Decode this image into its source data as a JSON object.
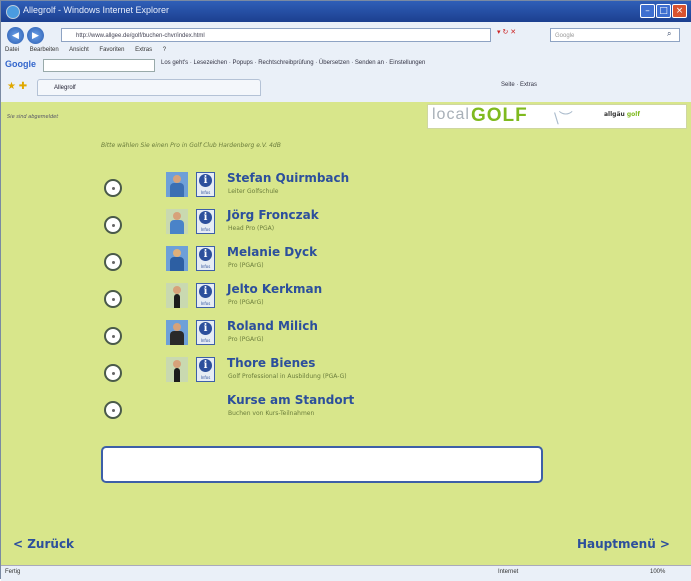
{
  "window": {
    "title": "Allegrolf - Windows Internet Explorer"
  },
  "browser": {
    "address": "http://www.allgee.de/golf/buchen-chvr/index.html",
    "search_placeholder": "Google",
    "menu": [
      "Datei",
      "Bearbeiten",
      "Ansicht",
      "Favoriten",
      "Extras",
      "?"
    ],
    "google_label": "Google",
    "google_tools": "Los  geht's  ·  Lesezeichen  ·  Popups  ·  Rechtschreibprüfung  ·  Übersetzen  ·  Senden an  ·  Einstellungen",
    "tab_title": "Allegrolf",
    "tab_tools": "Seite  ·  Extras"
  },
  "page": {
    "status_note": "Sie sind abgemeldet",
    "logo": {
      "local": "local",
      "golf": "GOLF",
      "partner_a": "allgäu",
      "partner_b": "golf"
    },
    "intro": "Bitte wählen Sie einen Pro in Golf Club Hardenberg e.V. 4dB",
    "pros": [
      {
        "name": "Stefan Quirmbach",
        "role": "Leiter Golfschule",
        "info": "Infos"
      },
      {
        "name": "Jörg Fronczak",
        "role": "Head Pro (PGA)",
        "info": "Infos"
      },
      {
        "name": "Melanie Dyck",
        "role": "Pro (PGArG)",
        "info": "Infos"
      },
      {
        "name": "Jelto Kerkman",
        "role": "Pro (PGArG)",
        "info": "Infos"
      },
      {
        "name": "Roland Milich",
        "role": "Pro (PGArG)",
        "info": "Infos"
      },
      {
        "name": "Thore Bienes",
        "role": "Golf Professional in Ausbildung (PGA-G)",
        "info": "Infos"
      },
      {
        "name": "Kurse am Standort",
        "role": "Buchen von Kurs-Teilnahmen"
      }
    ],
    "back_label": "< Zurück",
    "main_menu_label": "Hauptmenü >"
  },
  "statusbar": {
    "left": "Fertig",
    "zone": "Internet",
    "zoom": "100%"
  }
}
